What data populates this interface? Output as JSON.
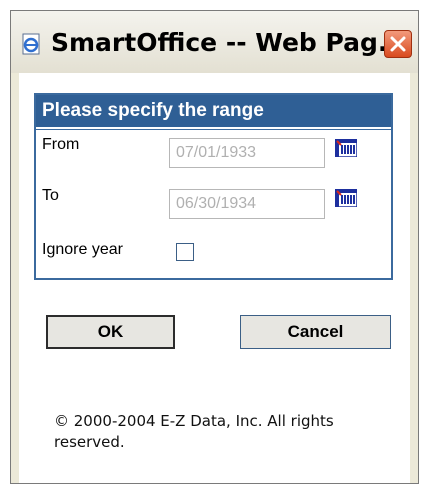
{
  "window": {
    "title": "SmartOffice -- Web Pag...",
    "icon": "ie-page-icon",
    "close_icon": "close-icon"
  },
  "range_panel": {
    "header": "Please specify the range",
    "from_label": "From",
    "from_value": "07/01/1933",
    "to_label": "To",
    "to_value": "06/30/1934",
    "ignore_year_label": "Ignore year",
    "ignore_year_checked": false,
    "calendar_icon": "calendar-icon"
  },
  "buttons": {
    "ok_label": "OK",
    "cancel_label": "Cancel"
  },
  "footer": {
    "copyright": "© 2000-2004 E-Z Data, Inc. All rights reserved."
  },
  "colors": {
    "panel_header_bg": "#2f5f95",
    "close_button": "#d94a1f",
    "disabled_text": "#b0b0b0"
  }
}
